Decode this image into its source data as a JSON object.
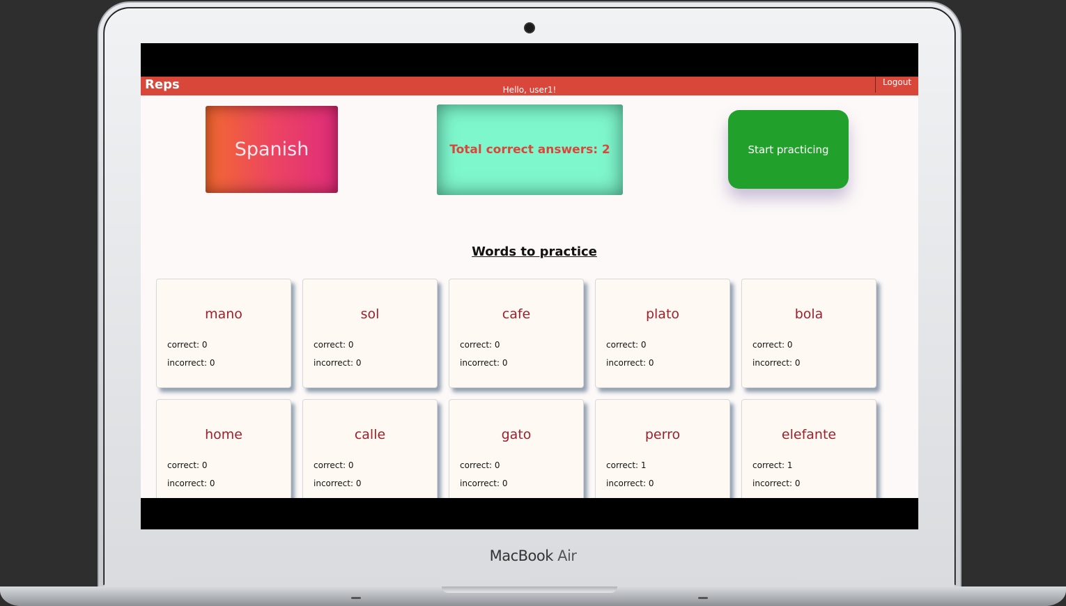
{
  "device": {
    "brand": "MacBook",
    "model": "Air"
  },
  "navbar": {
    "brand": "Reps",
    "greeting": "Hello, user1!",
    "logout_label": "Logout"
  },
  "summary": {
    "language": "Spanish",
    "total_correct": "Total correct answers: 2",
    "start_label": "Start practicing"
  },
  "words_section": {
    "title": "Words to practice"
  },
  "words": [
    {
      "word": "mano",
      "correct": "correct: 0",
      "incorrect": "incorrect: 0"
    },
    {
      "word": "sol",
      "correct": "correct: 0",
      "incorrect": "incorrect: 0"
    },
    {
      "word": "cafe",
      "correct": "correct: 0",
      "incorrect": "incorrect: 0"
    },
    {
      "word": "plato",
      "correct": "correct: 0",
      "incorrect": "incorrect: 0"
    },
    {
      "word": "bola",
      "correct": "correct: 0",
      "incorrect": "incorrect: 0"
    },
    {
      "word": "home",
      "correct": "correct: 0",
      "incorrect": "incorrect: 0"
    },
    {
      "word": "calle",
      "correct": "correct: 0",
      "incorrect": "incorrect: 0"
    },
    {
      "word": "gato",
      "correct": "correct: 0",
      "incorrect": "incorrect: 0"
    },
    {
      "word": "perro",
      "correct": "correct: 1",
      "incorrect": "incorrect: 0"
    },
    {
      "word": "elefante",
      "correct": "correct: 1",
      "incorrect": "incorrect: 0"
    }
  ],
  "colors": {
    "navbar": "#d9473b",
    "start_button": "#21a12c",
    "total_card": "#7ff7cd",
    "word_text": "#9e1f2b"
  }
}
